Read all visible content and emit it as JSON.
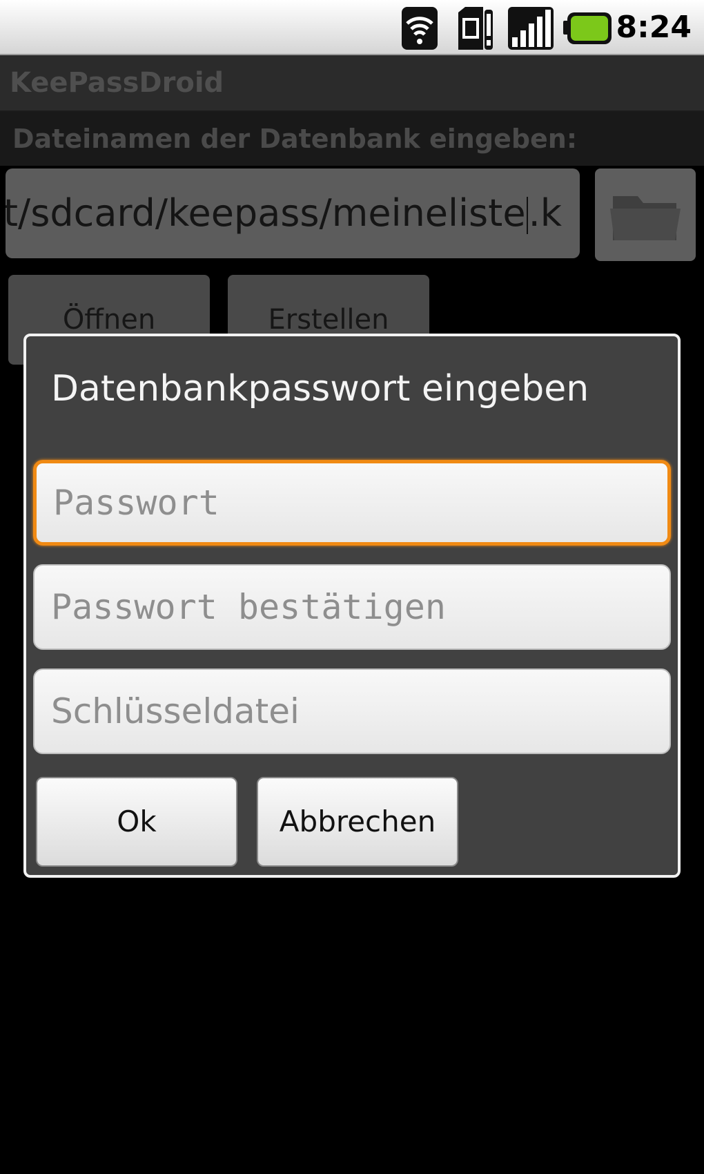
{
  "status_bar": {
    "time": "8:24",
    "icons": [
      "wifi-icon",
      "sim-alert-icon",
      "signal-icon",
      "battery-icon"
    ],
    "battery_color": "#7cc81a"
  },
  "app": {
    "title": "KeePassDroid",
    "prompt": "Dateinamen der Datenbank eingeben:",
    "filename_value": "nt/sdcard/keepass/meineliste.k",
    "filename_before_caret": "nt/sdcard/keepass/meineliste",
    "filename_after_caret": ".k",
    "open_label": "Öffnen",
    "create_label": "Erstellen"
  },
  "dialog": {
    "title": "Datenbankpasswort eingeben",
    "password_placeholder": "Passwort",
    "password_confirm_placeholder": "Passwort bestätigen",
    "keyfile_placeholder": "Schlüsseldatei",
    "ok_label": "Ok",
    "cancel_label": "Abbrechen",
    "focus_color": "#f08a14"
  }
}
